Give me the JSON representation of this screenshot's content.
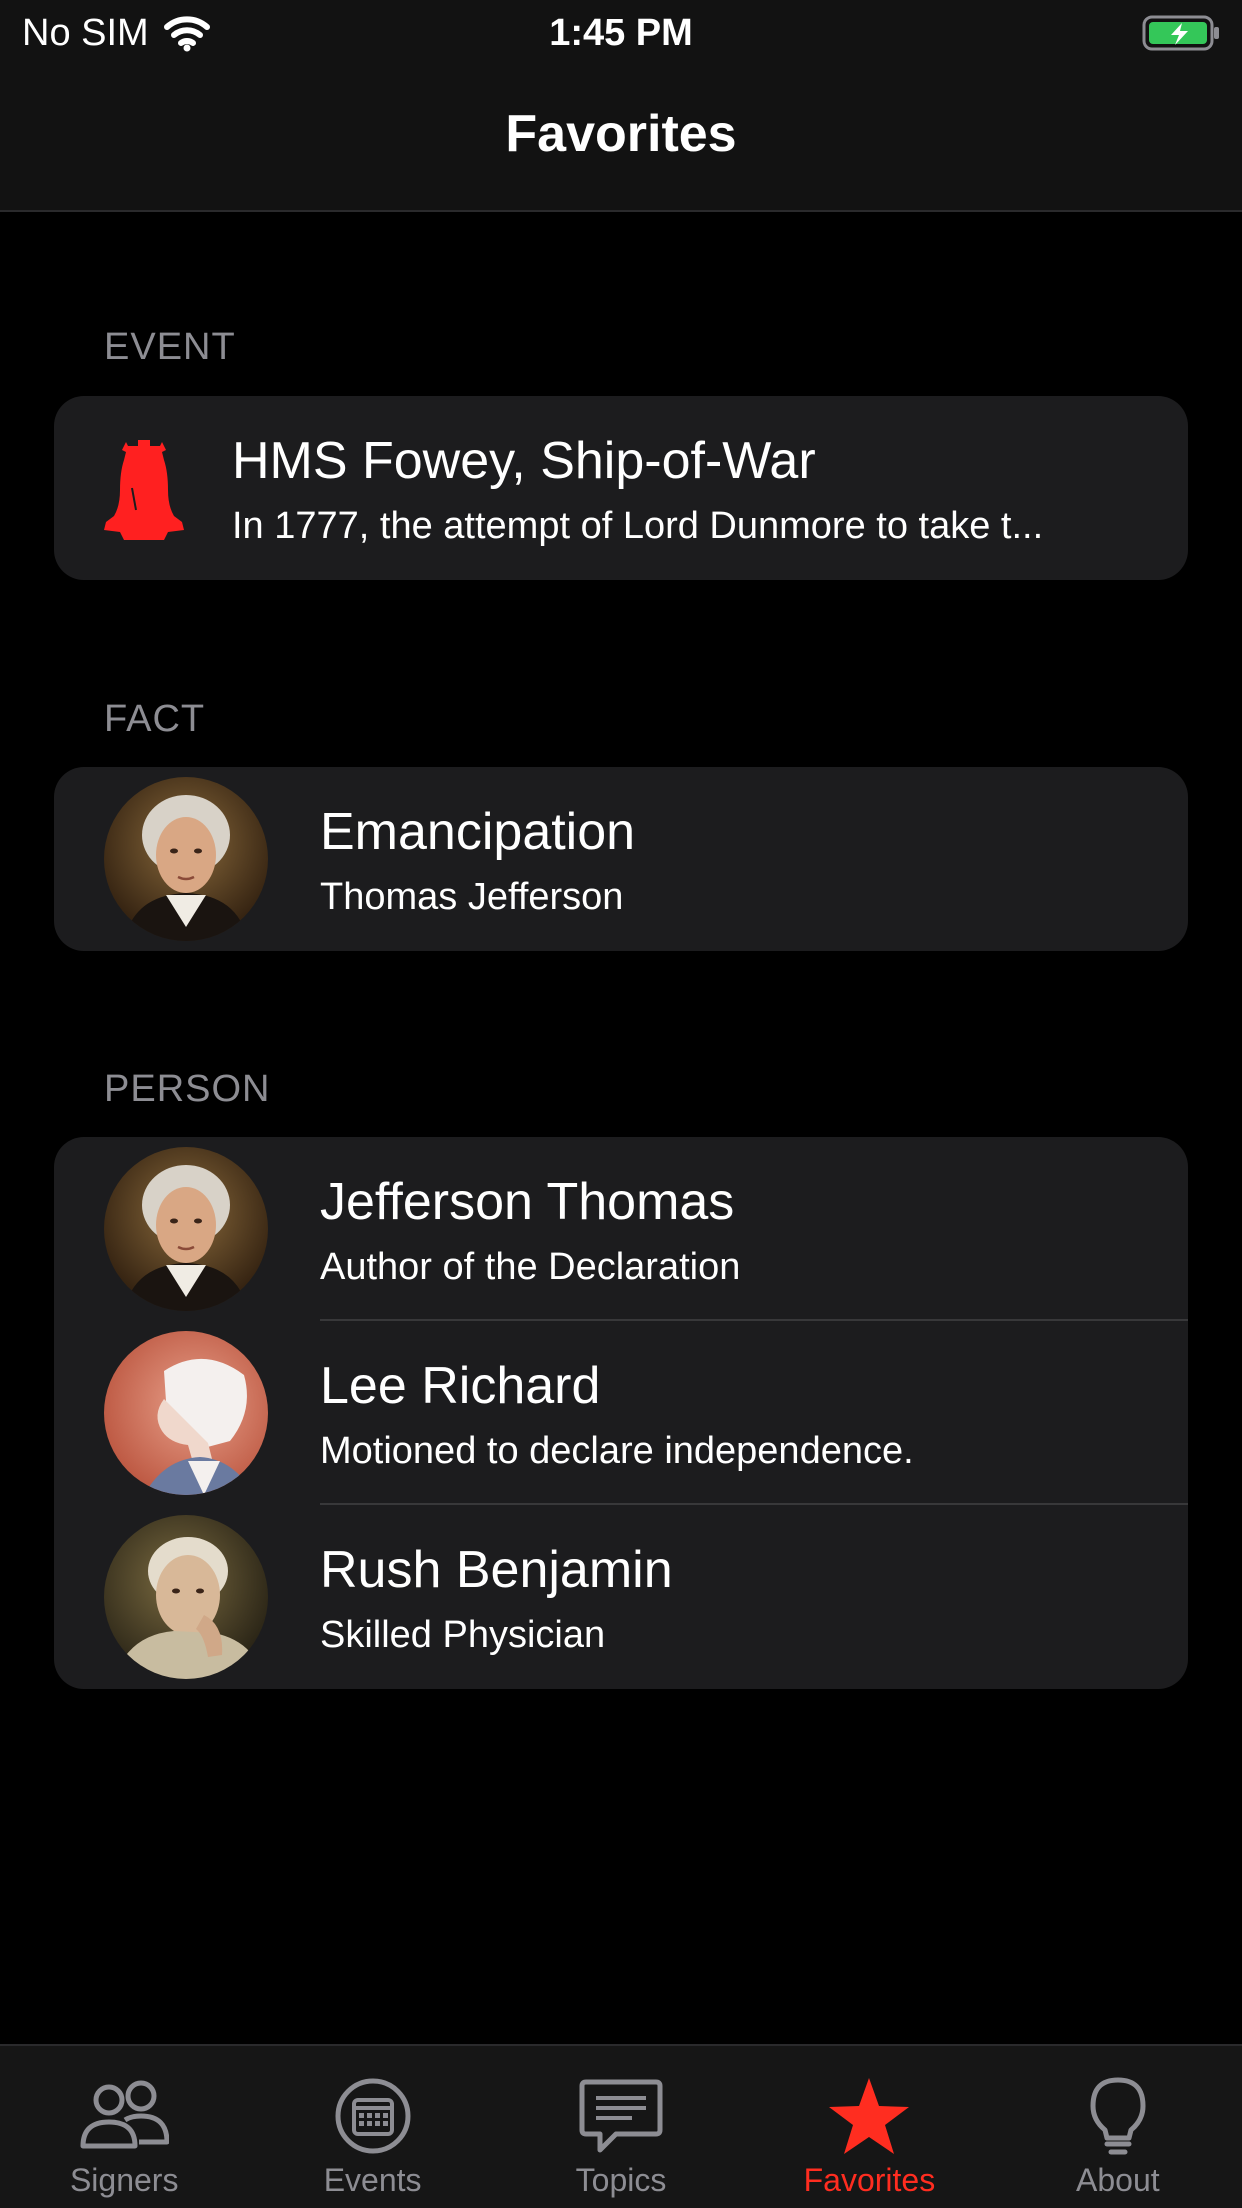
{
  "status_bar": {
    "carrier": "No SIM",
    "time": "1:45 PM"
  },
  "nav": {
    "title": "Favorites"
  },
  "sections": [
    {
      "header": "EVENT",
      "items": [
        {
          "title": "HMS Fowey, Ship-of-War",
          "subtitle": "In 1777, the attempt of Lord Dunmore to take t..."
        }
      ]
    },
    {
      "header": "FACT",
      "items": [
        {
          "title": "Emancipation",
          "subtitle": "Thomas Jefferson"
        }
      ]
    },
    {
      "header": "PERSON",
      "items": [
        {
          "title": "Jefferson Thomas",
          "subtitle": "Author of the Declaration"
        },
        {
          "title": "Lee Richard",
          "subtitle": "Motioned to declare independence."
        },
        {
          "title": "Rush Benjamin",
          "subtitle": "Skilled Physician"
        }
      ]
    }
  ],
  "tabs": [
    {
      "label": "Signers",
      "icon": "people-icon",
      "active": false
    },
    {
      "label": "Events",
      "icon": "calendar-icon",
      "active": false
    },
    {
      "label": "Topics",
      "icon": "chat-bubble-icon",
      "active": false
    },
    {
      "label": "Favorites",
      "icon": "star-icon",
      "active": true
    },
    {
      "label": "About",
      "icon": "lightbulb-icon",
      "active": false
    }
  ],
  "colors": {
    "accent": "#ff2d20",
    "background": "#000000",
    "card": "#1c1c1e",
    "secondary_text": "#8d8d93",
    "battery": "#34c759"
  }
}
